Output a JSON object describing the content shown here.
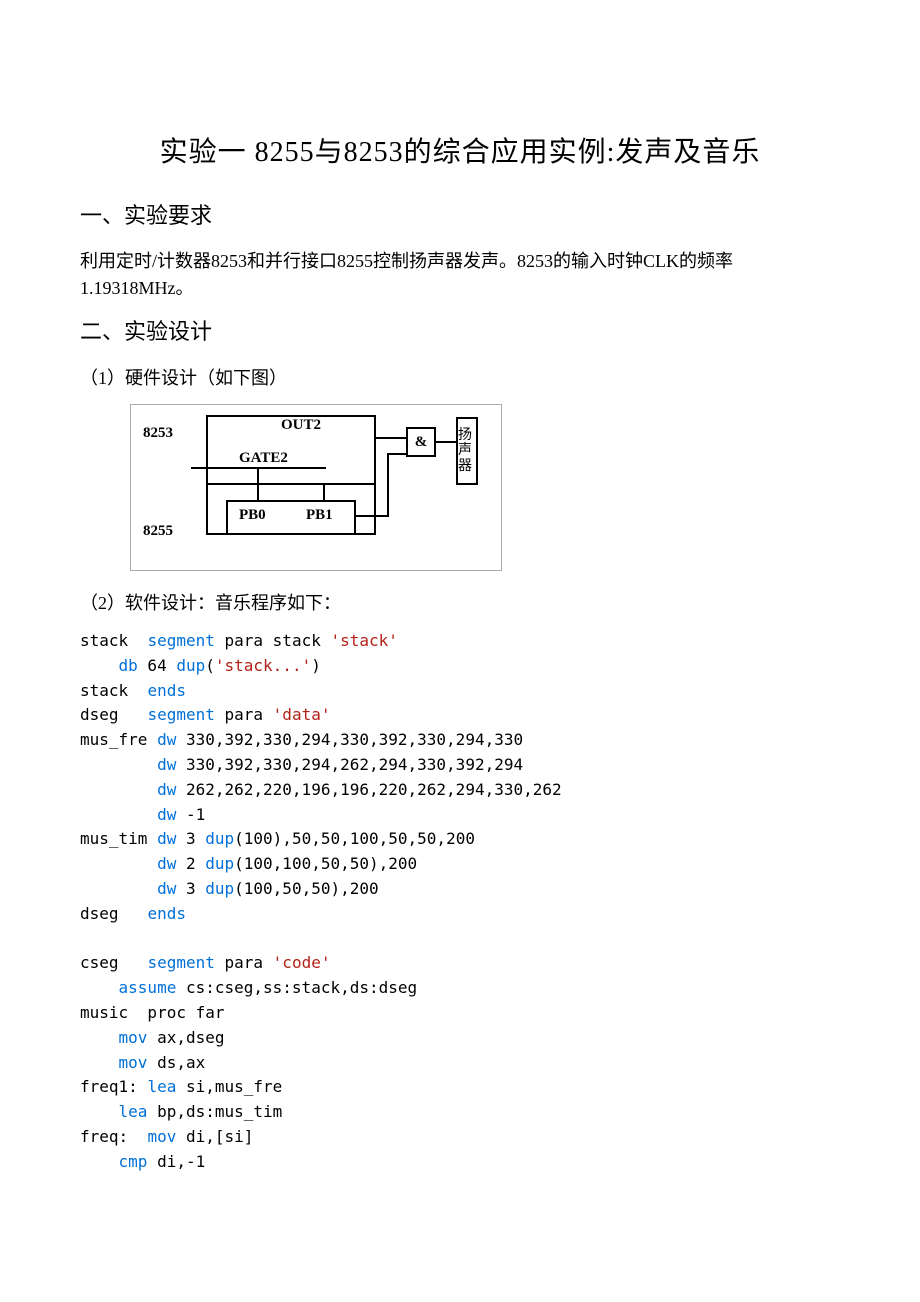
{
  "title": "实验一 8255与8253的综合应用实例:发声及音乐",
  "section1_heading": "一、实验要求",
  "requirement_text": "利用定时/计数器8253和并行接口8255控制扬声器发声。8253的输入时钟CLK的频率1.19318MHz。",
  "section2_heading": "二、实验设计",
  "hw_heading": "（1）硬件设计（如下图）",
  "diagram": {
    "t8253": "8253",
    "out2": "OUT2",
    "gate2": "GATE2",
    "and": "&",
    "speaker": "扬声器",
    "pb0": "PB0",
    "pb1": "PB1",
    "t8255": "8255"
  },
  "sw_heading": "（2）软件设计：音乐程序如下：",
  "code": {
    "l01a": "stack  ",
    "l01b": "segment",
    "l01c": " para stack ",
    "l01d": "'stack'",
    "l02a": "    ",
    "l02b": "db",
    "l02c": " 64 ",
    "l02d": "dup",
    "l02e": "(",
    "l02f": "'stack...'",
    "l02g": ")",
    "l03a": "stack  ",
    "l03b": "ends",
    "l04a": "dseg   ",
    "l04b": "segment",
    "l04c": " para ",
    "l04d": "'data'",
    "l05a": "mus_fre ",
    "l05b": "dw",
    "l05c": " 330,392,330,294,330,392,330,294,330",
    "l06a": "        ",
    "l06b": "dw",
    "l06c": " 330,392,330,294,262,294,330,392,294",
    "l07a": "        ",
    "l07b": "dw",
    "l07c": " 262,262,220,196,196,220,262,294,330,262",
    "l08a": "        ",
    "l08b": "dw",
    "l08c": " -1",
    "l09a": "mus_tim ",
    "l09b": "dw",
    "l09c": " 3 ",
    "l09d": "dup",
    "l09e": "(100),50,50,100,50,50,200",
    "l10a": "        ",
    "l10b": "dw",
    "l10c": " 2 ",
    "l10d": "dup",
    "l10e": "(100,100,50,50),200",
    "l11a": "        ",
    "l11b": "dw",
    "l11c": " 3 ",
    "l11d": "dup",
    "l11e": "(100,50,50),200",
    "l12a": "dseg   ",
    "l12b": "ends",
    "blank": "",
    "l14a": "cseg   ",
    "l14b": "segment",
    "l14c": " para ",
    "l14d": "'code'",
    "l15a": "    ",
    "l15b": "assume",
    "l15c": " cs:cseg,ss:stack,ds:dseg",
    "l16a": "music  proc far",
    "l17a": "    ",
    "l17b": "mov",
    "l17c": " ax,dseg",
    "l18a": "    ",
    "l18b": "mov",
    "l18c": " ds,ax",
    "l19a": "freq1: ",
    "l19b": "lea",
    "l19c": " si,mus_fre",
    "l20a": "    ",
    "l20b": "lea",
    "l20c": " bp,ds:mus_tim",
    "l21a": "freq:  ",
    "l21b": "mov",
    "l21c": " di,[si]",
    "l22a": "    ",
    "l22b": "cmp",
    "l22c": " di,-1"
  }
}
